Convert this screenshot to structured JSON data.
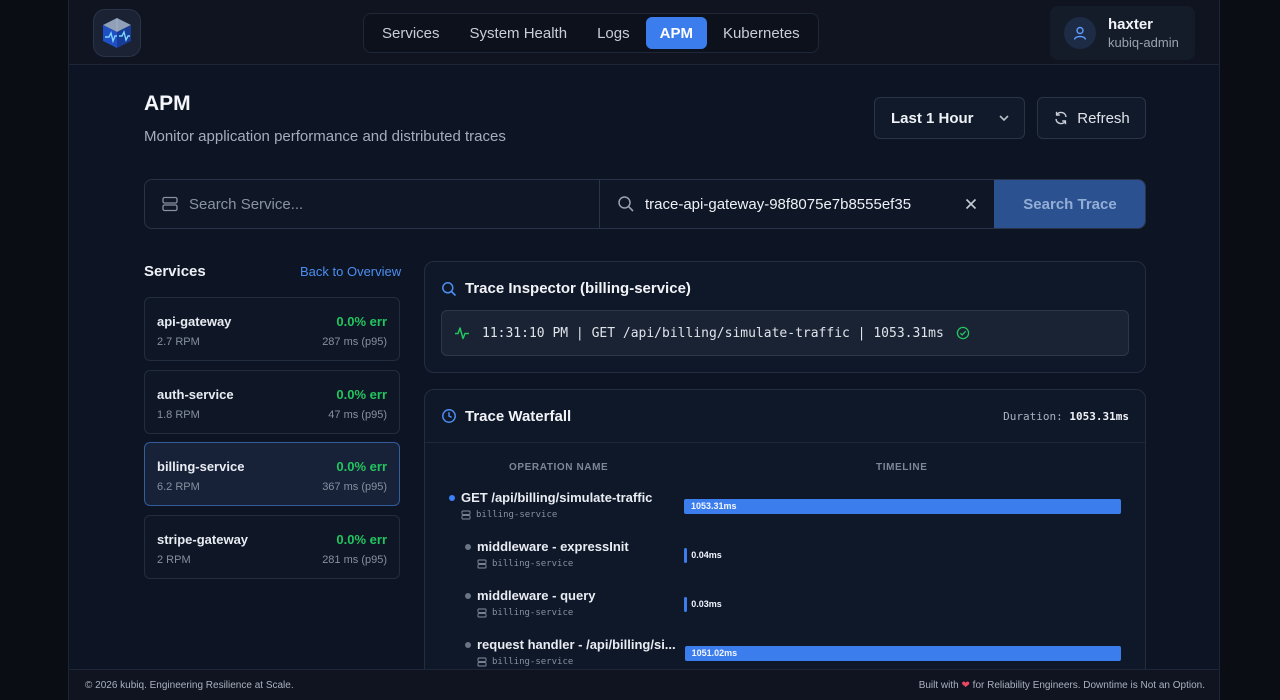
{
  "nav": {
    "items": [
      {
        "label": "Services",
        "active": false
      },
      {
        "label": "System Health",
        "active": false
      },
      {
        "label": "Logs",
        "active": false
      },
      {
        "label": "APM",
        "active": true
      },
      {
        "label": "Kubernetes",
        "active": false
      }
    ]
  },
  "user": {
    "name": "haxter",
    "role": "kubiq-admin"
  },
  "page": {
    "title": "APM",
    "subtitle": "Monitor application performance and distributed traces",
    "time_range": "Last 1 Hour",
    "refresh_label": "Refresh"
  },
  "search": {
    "service_placeholder": "Search Service...",
    "trace_value": "trace-api-gateway-98f8075e7b8555ef35",
    "button_label": "Search Trace"
  },
  "services": {
    "heading": "Services",
    "back_label": "Back to Overview",
    "items": [
      {
        "name": "api-gateway",
        "err": "0.0% err",
        "rpm": "2.7 RPM",
        "latency": "287 ms (p95)",
        "selected": false
      },
      {
        "name": "auth-service",
        "err": "0.0% err",
        "rpm": "1.8 RPM",
        "latency": "47 ms (p95)",
        "selected": false
      },
      {
        "name": "billing-service",
        "err": "0.0% err",
        "rpm": "6.2 RPM",
        "latency": "367 ms (p95)",
        "selected": true
      },
      {
        "name": "stripe-gateway",
        "err": "0.0% err",
        "rpm": "2 RPM",
        "latency": "281 ms (p95)",
        "selected": false
      }
    ]
  },
  "inspector": {
    "title": "Trace Inspector (billing-service)",
    "trace_line": "11:31:10 PM | GET /api/billing/simulate-traffic | 1053.31ms"
  },
  "waterfall": {
    "title": "Trace Waterfall",
    "duration_label": "Duration:",
    "duration_value": "1053.31ms",
    "col_operation": "OPERATION NAME",
    "col_timeline": "TIMELINE",
    "total_ms": 1053.31,
    "spans": [
      {
        "name": "GET /api/billing/simulate-traffic",
        "service": "billing-service",
        "duration_label": "1053.31ms",
        "duration_ms": 1053.31,
        "start_ms": 0,
        "depth": 0
      },
      {
        "name": "middleware - expressInit",
        "service": "billing-service",
        "duration_label": "0.04ms",
        "duration_ms": 0.04,
        "start_ms": 0.5,
        "depth": 1
      },
      {
        "name": "middleware - query",
        "service": "billing-service",
        "duration_label": "0.03ms",
        "duration_ms": 0.03,
        "start_ms": 0.6,
        "depth": 1
      },
      {
        "name": "request handler - /api/billing/si...",
        "service": "billing-service",
        "duration_label": "1051.02ms",
        "duration_ms": 1051.02,
        "start_ms": 1.5,
        "depth": 1
      }
    ]
  },
  "footer": {
    "left": "© 2026 kubiq. Engineering Resilience at Scale.",
    "right_prefix": "Built with",
    "right_suffix": "for Reliability Engineers. Downtime is Not an Option."
  }
}
